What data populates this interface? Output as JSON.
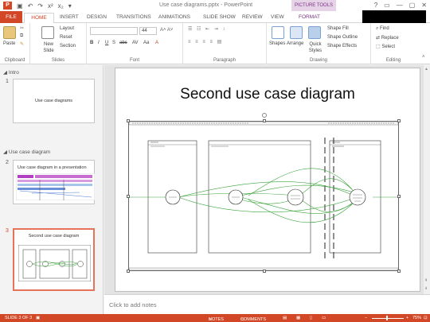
{
  "window": {
    "title": "Use case diagrams.pptx - PowerPoint",
    "contextual_tab_group": "PICTURE TOOLS",
    "controls": [
      "?",
      "▭",
      "—",
      "▢",
      "✕"
    ]
  },
  "tabs": [
    "FILE",
    "HOME",
    "INSERT",
    "DESIGN",
    "TRANSITIONS",
    "ANIMATIONS",
    "SLIDE SHOW",
    "REVIEW",
    "VIEW",
    "FORMAT"
  ],
  "ribbon": {
    "clipboard": {
      "label": "Clipboard",
      "paste": "Paste"
    },
    "slides": {
      "label": "Slides",
      "new_slide": "New Slide",
      "layout": "Layout",
      "reset": "Reset",
      "section": "Section"
    },
    "font": {
      "label": "Font",
      "size": "44",
      "buttons": [
        "B",
        "I",
        "U",
        "S",
        "abc",
        "AV",
        "Aa",
        "A"
      ]
    },
    "paragraph": {
      "label": "Paragraph"
    },
    "drawing": {
      "label": "Drawing",
      "shapes": "Shapes",
      "arrange": "Arrange",
      "quick_styles": "Quick Styles",
      "shape_fill": "Shape Fill",
      "shape_outline": "Shape Outline",
      "shape_effects": "Shape Effects"
    },
    "editing": {
      "label": "Editing",
      "find": "Find",
      "replace": "Replace",
      "select": "Select"
    }
  },
  "sidebar": {
    "sections": [
      {
        "name": "Intro"
      },
      {
        "name": "Use case diagram"
      }
    ],
    "slides": [
      {
        "number": "1",
        "title": "Use case diagrams"
      },
      {
        "number": "2",
        "title": "Use case diagram in a presentation"
      },
      {
        "number": "3",
        "title": "Second use case diagram"
      }
    ]
  },
  "slide": {
    "title": "Second use case diagram"
  },
  "notes": {
    "placeholder": "Click to add notes"
  },
  "status": {
    "slide_info": "SLIDE 3 OF 3",
    "notes": "NOTES",
    "comments": "COMMENTS",
    "zoom": "75%"
  },
  "colors": {
    "accent": "#d24726",
    "picture_tools": "#7a3580",
    "connector": "#3aa23a"
  }
}
